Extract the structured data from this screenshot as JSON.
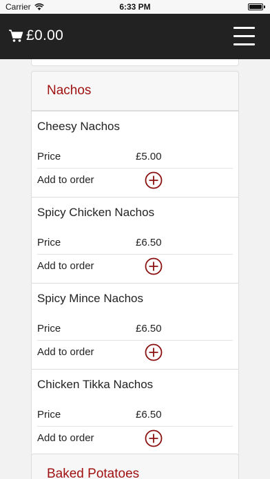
{
  "status": {
    "carrier": "Carrier",
    "time": "6:33 PM"
  },
  "header": {
    "cart_total": "£0.00"
  },
  "section": {
    "title": "Nachos",
    "items": [
      {
        "name": "Cheesy Nachos",
        "price_label": "Price",
        "price": "£5.00",
        "add_label": "Add to order"
      },
      {
        "name": "Spicy Chicken Nachos",
        "price_label": "Price",
        "price": "£6.50",
        "add_label": "Add to order"
      },
      {
        "name": "Spicy Mince Nachos",
        "price_label": "Price",
        "price": "£6.50",
        "add_label": "Add to order"
      },
      {
        "name": "Chicken Tikka Nachos",
        "price_label": "Price",
        "price": "£6.50",
        "add_label": "Add to order"
      }
    ]
  },
  "next_section": {
    "title": "Baked Potatoes"
  },
  "colors": {
    "accent": "#a01212",
    "navbar": "#222222"
  }
}
